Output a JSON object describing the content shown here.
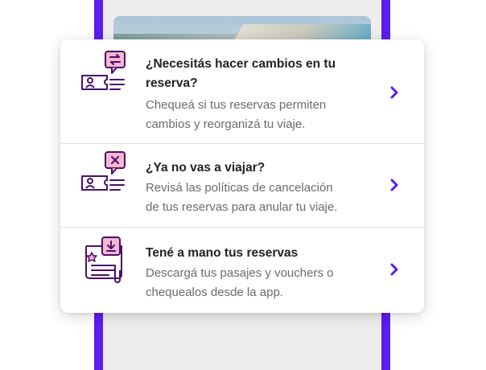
{
  "colors": {
    "brand": "#5b1df0",
    "icon_stroke": "#4b0f6b",
    "icon_fill_pink": "#f6b8cf",
    "title": "#222222",
    "description": "#6b6b6b"
  },
  "help_items": [
    {
      "title_line1": "¿Necesitás hacer cambios en tu",
      "title_line2": "reserva?",
      "desc_line1": "Chequeá si tus reservas permiten",
      "desc_line2": "cambios y reorganizá tu viaje.",
      "icon": "change-reservation-icon"
    },
    {
      "title_line1": "¿Ya no vas a viajar?",
      "desc_line1": "Revisá las políticas de cancelación",
      "desc_line2": "de tus reservas para anular tu viaje.",
      "icon": "cancel-reservation-icon"
    },
    {
      "title_line1": "Tené a mano tus reservas",
      "desc_line1": "Descargá tus pasajes y vouchers o",
      "desc_line2": "chequealos desde la app.",
      "icon": "download-reservation-icon"
    }
  ]
}
